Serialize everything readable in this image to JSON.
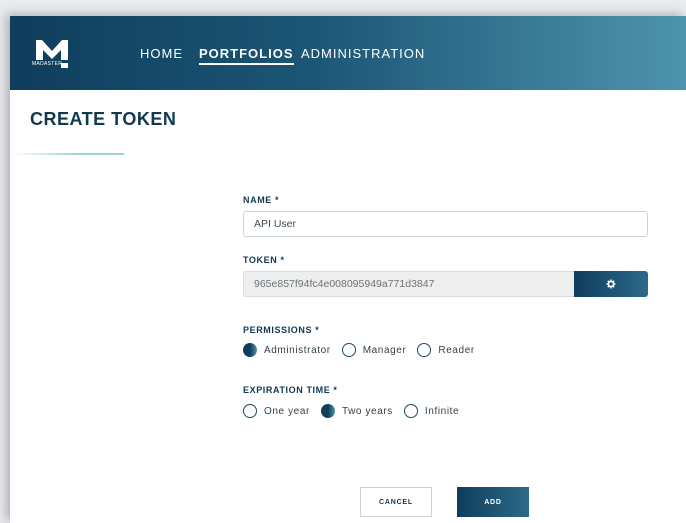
{
  "brand": {
    "logo_text": "MADASTER"
  },
  "nav": {
    "home": "HOME",
    "portfolios": "PORTFOLIOS",
    "administration": "ADMINISTRATION"
  },
  "page": {
    "title": "CREATE TOKEN"
  },
  "form": {
    "name_label": "NAME *",
    "name_value": "API User",
    "token_label": "TOKEN *",
    "token_value": "965e857f94fc4e008095949a771d3847",
    "permissions_label": "PERMISSIONS *",
    "permissions": [
      {
        "label": "Administrator",
        "checked": true
      },
      {
        "label": "Manager",
        "checked": false
      },
      {
        "label": "Reader",
        "checked": false
      }
    ],
    "expiration_label": "EXPIRATION TIME *",
    "expiration": [
      {
        "label": "One year",
        "checked": false
      },
      {
        "label": "Two years",
        "checked": true
      },
      {
        "label": "Infinite",
        "checked": false
      }
    ]
  },
  "actions": {
    "cancel": "CANCEL",
    "add": "ADD"
  },
  "colors": {
    "primary": "#0f3d5c",
    "accent": "#4e94ad",
    "title": "#12384f"
  }
}
